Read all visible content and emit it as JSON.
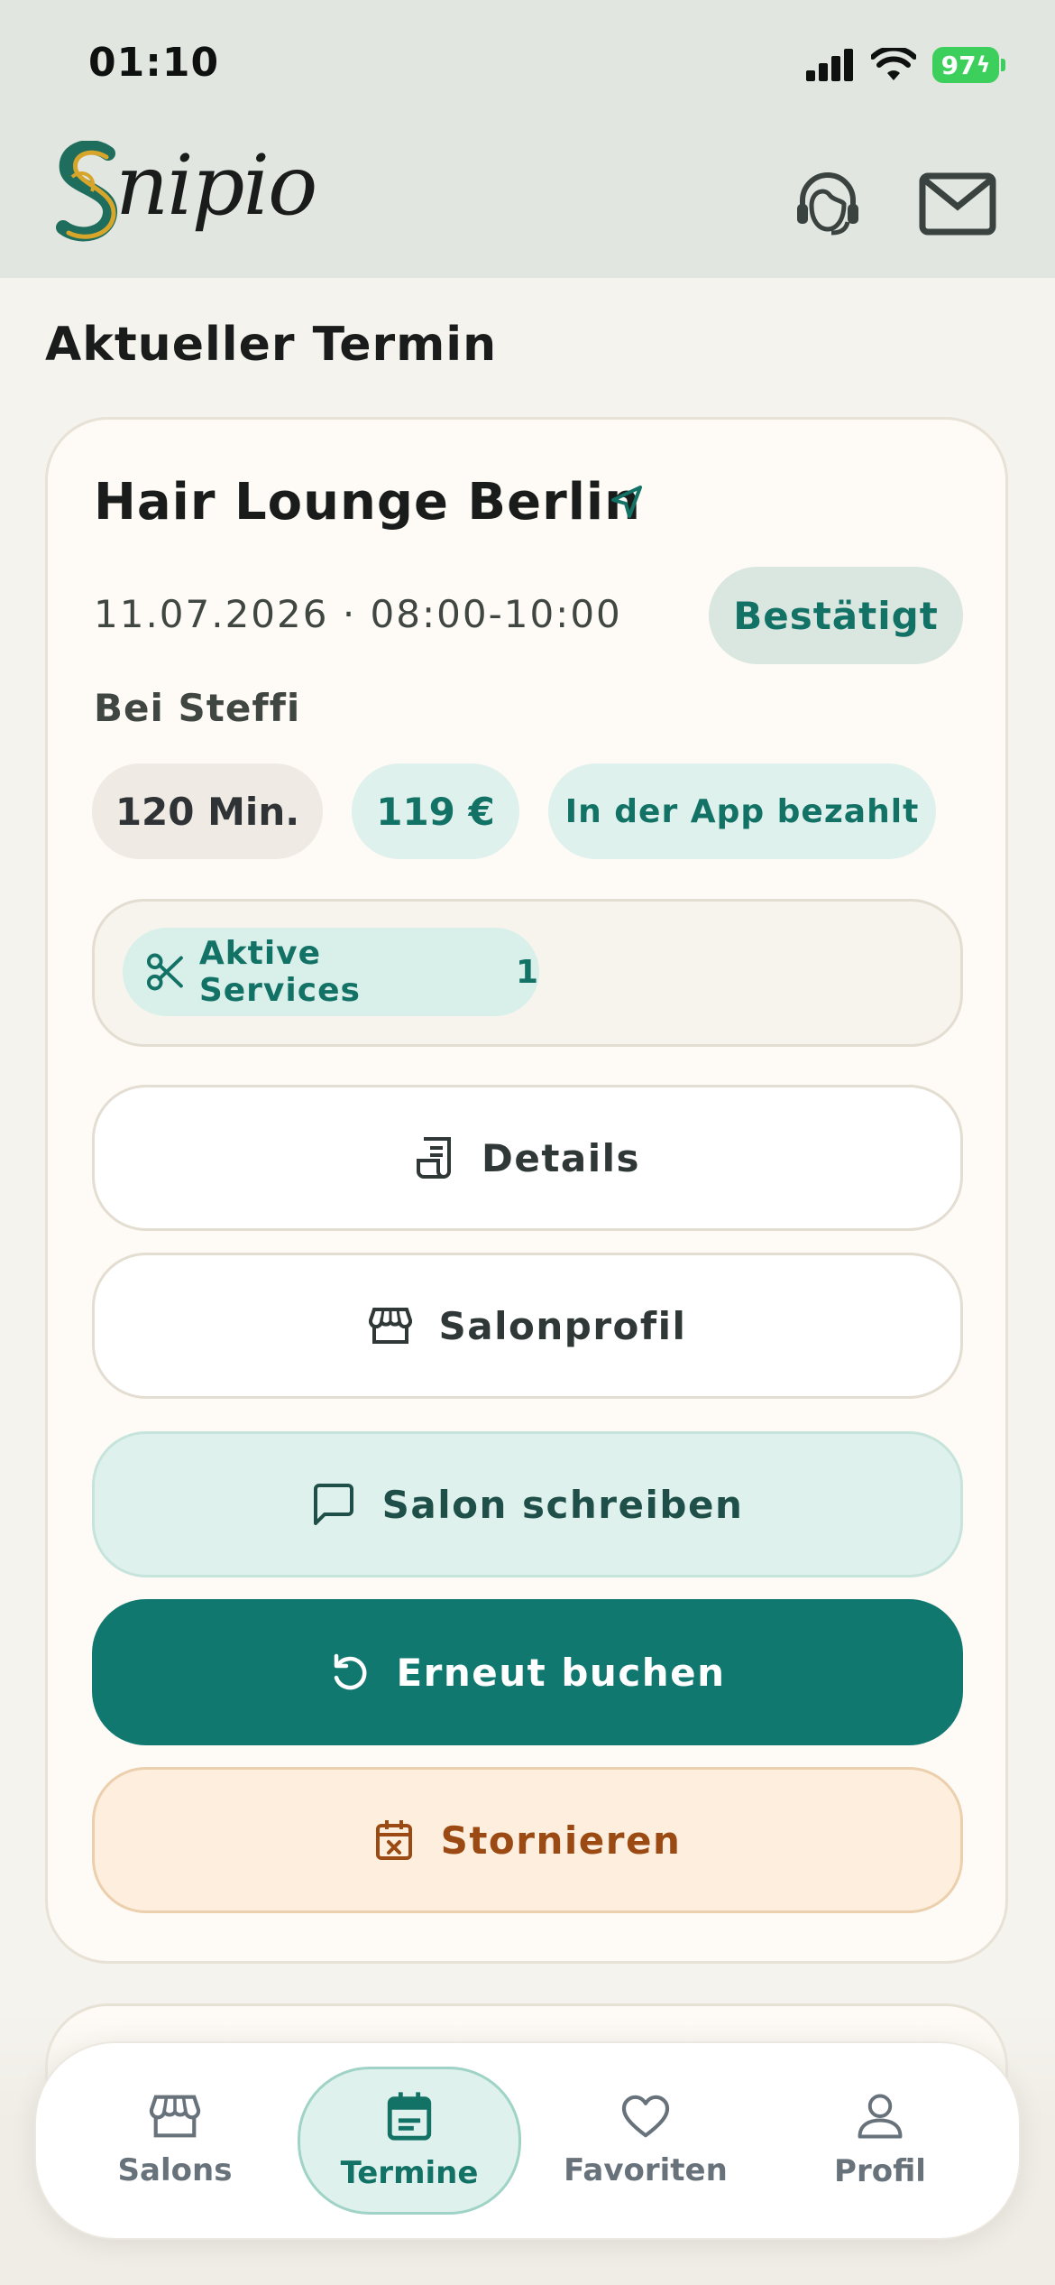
{
  "status_bar": {
    "time": "01:10",
    "battery": "97"
  },
  "header": {
    "logo_text": "nipio",
    "logo_initial": "S",
    "support_icon": "headset-icon",
    "mail_icon": "mail-icon"
  },
  "page": {
    "section_title": "Aktueller Termin"
  },
  "appointment": {
    "salon_name": "Hair Lounge Berlin",
    "date_time": "11.07.2026 · 08:00-10:00",
    "status": "Bestätigt",
    "stylist": "Bei Steffi",
    "duration": "120 Min.",
    "price": "119 €",
    "payment": "In der App bezahlt",
    "services_label": "Aktive Services",
    "services_count": "1"
  },
  "actions": {
    "details": "Details",
    "salon_profile": "Salonprofil",
    "message": "Salon schreiben",
    "rebook": "Erneut buchen",
    "cancel": "Stornieren"
  },
  "tabbar": {
    "items": [
      {
        "label": "Salons",
        "icon": "store-icon"
      },
      {
        "label": "Termine",
        "icon": "calendar-icon",
        "active": true
      },
      {
        "label": "Favoriten",
        "icon": "heart-icon"
      },
      {
        "label": "Profil",
        "icon": "person-icon"
      }
    ]
  },
  "colors": {
    "primary": "#117870",
    "primary_light": "#dff1ec",
    "cancel_bg": "#fdeedd",
    "cancel_text": "#9a4a12",
    "header_bg": "#e1e6e0"
  }
}
